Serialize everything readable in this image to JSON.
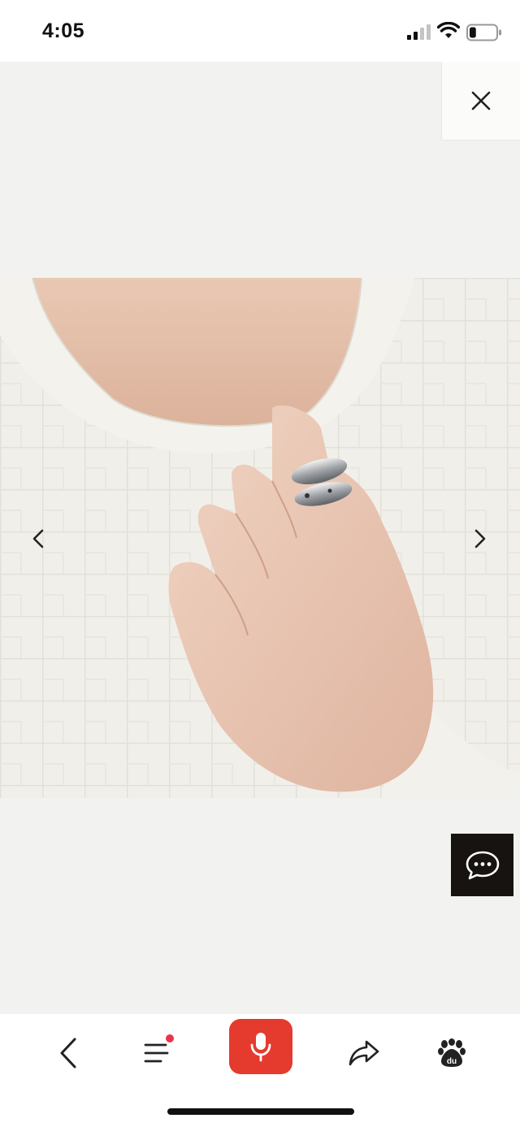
{
  "status_bar": {
    "time": "4:05",
    "signal_icon": "cellular-signal-icon",
    "wifi_icon": "wifi-icon",
    "battery_icon": "battery-icon",
    "battery_level": 0.25
  },
  "viewer": {
    "close_icon": "close-icon",
    "photo_description_icon": "product-photo",
    "prev_icon": "chevron-left-icon",
    "next_icon": "chevron-right-icon",
    "chat_icon": "chat-bubble-icon"
  },
  "toolbar": {
    "back_icon": "back-arrow-icon",
    "menu_icon": "menu-icon",
    "menu_has_notification": true,
    "mic_icon": "microphone-icon",
    "share_icon": "share-icon",
    "paw_icon": "baidu-paw-icon",
    "paw_text": "du"
  },
  "colors": {
    "accent_red": "#e53a2e",
    "notification_dot": "#e8354a",
    "chat_button_bg": "#161310",
    "viewer_bg": "#f2f2f0"
  }
}
